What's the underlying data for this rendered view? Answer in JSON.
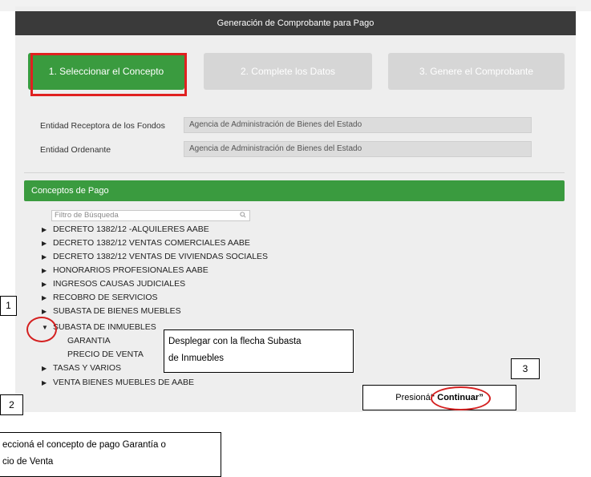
{
  "header": {
    "title": "Generación de Comprobante para Pago"
  },
  "steps": [
    {
      "label": "1. Seleccionar el Concepto"
    },
    {
      "label": "2. Complete los Datos"
    },
    {
      "label": "3. Genere el Comprobante"
    }
  ],
  "fields": [
    {
      "label": "Entidad Receptora de los Fondos",
      "value": "Agencia de Administración de Bienes del Estado"
    },
    {
      "label": "Entidad Ordenante",
      "value": "Agencia de Administración de Bienes del Estado"
    }
  ],
  "concepts": {
    "title": "Conceptos de Pago",
    "filter_placeholder": "Filtro de Búsqueda",
    "items": [
      {
        "label": "DECRETO 1382/12 -ALQUILERES AABE"
      },
      {
        "label": "DECRETO 1382/12 VENTAS COMERCIALES AABE"
      },
      {
        "label": "DECRETO 1382/12 VENTAS DE VIVIENDAS SOCIALES"
      },
      {
        "label": "HONORARIOS PROFESIONALES AABE"
      },
      {
        "label": "INGRESOS CAUSAS JUDICIALES"
      },
      {
        "label": "RECOBRO DE SERVICIOS"
      },
      {
        "label": "SUBASTA DE BIENES MUEBLES"
      },
      {
        "label": "SUBASTA DE INMUEBLES",
        "children": [
          "GARANTIA",
          "PRECIO DE VENTA"
        ]
      },
      {
        "label": "TASAS Y VARIOS"
      },
      {
        "label": "VENTA BIENES MUEBLES DE AABE"
      }
    ]
  },
  "annotations": {
    "num1": "1",
    "num2": "2",
    "num3": "3",
    "callout_expand_line1": "Desplegar con la flecha Subasta",
    "callout_expand_line2": "de Inmuebles",
    "callout_continue_prefix": "Presioná",
    "callout_continue_bold": "“ Continuar”",
    "callout_select_line1": "eccioná el concepto de pago Garantía o",
    "callout_select_line2": "cio de Venta"
  },
  "colors": {
    "header_bg": "#3a3a3a",
    "accent_green": "#3a9b3f",
    "inactive_step": "#d6d6d6",
    "annotation_red": "#e02020"
  }
}
